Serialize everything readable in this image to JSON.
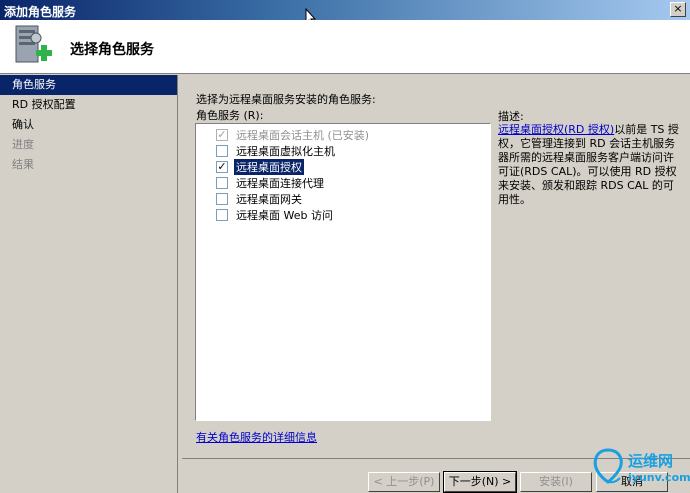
{
  "window": {
    "title": "添加角色服务",
    "close_glyph": "×"
  },
  "header": {
    "title": "选择角色服务"
  },
  "nav": {
    "items": [
      {
        "label": "角色服务",
        "state": "active"
      },
      {
        "label": "RD 授权配置",
        "state": "normal"
      },
      {
        "label": "确认",
        "state": "normal"
      },
      {
        "label": "进度",
        "state": "disabled"
      },
      {
        "label": "结果",
        "state": "disabled"
      }
    ]
  },
  "content": {
    "instruction": "选择为远程桌面服务安装的角色服务:",
    "list_label": "角色服务 (R):",
    "services": [
      {
        "label": "远程桌面会话主机   (已安装)",
        "checked": true,
        "disabled": true,
        "selected": false
      },
      {
        "label": "远程桌面虚拟化主机",
        "checked": false,
        "disabled": false,
        "selected": false
      },
      {
        "label": "远程桌面授权",
        "checked": true,
        "disabled": false,
        "selected": true
      },
      {
        "label": "远程桌面连接代理",
        "checked": false,
        "disabled": false,
        "selected": false
      },
      {
        "label": "远程桌面网关",
        "checked": false,
        "disabled": false,
        "selected": false
      },
      {
        "label": "远程桌面 Web 访问",
        "checked": false,
        "disabled": false,
        "selected": false
      }
    ],
    "description_title": "描述:",
    "description_link": "远程桌面授权(RD 授权)",
    "description_text": "以前是 TS 授权，它管理连接到 RD 会话主机服务器所需的远程桌面服务客户端访问许可证(RDS CAL)。可以使用 RD 授权来安装、颁发和跟踪 RDS CAL 的可用性。",
    "more_info_link": "有关角色服务的详细信息"
  },
  "footer": {
    "prev": "< 上一步(P)",
    "next": "下一步(N) >",
    "install": "安装(I)",
    "cancel": "取消"
  },
  "watermark": {
    "line1": "运维网",
    "line2": "iyunv.com"
  },
  "colors": {
    "selection": "#0a246a",
    "link": "#0000cc",
    "dialog": "#d4d0c8"
  }
}
